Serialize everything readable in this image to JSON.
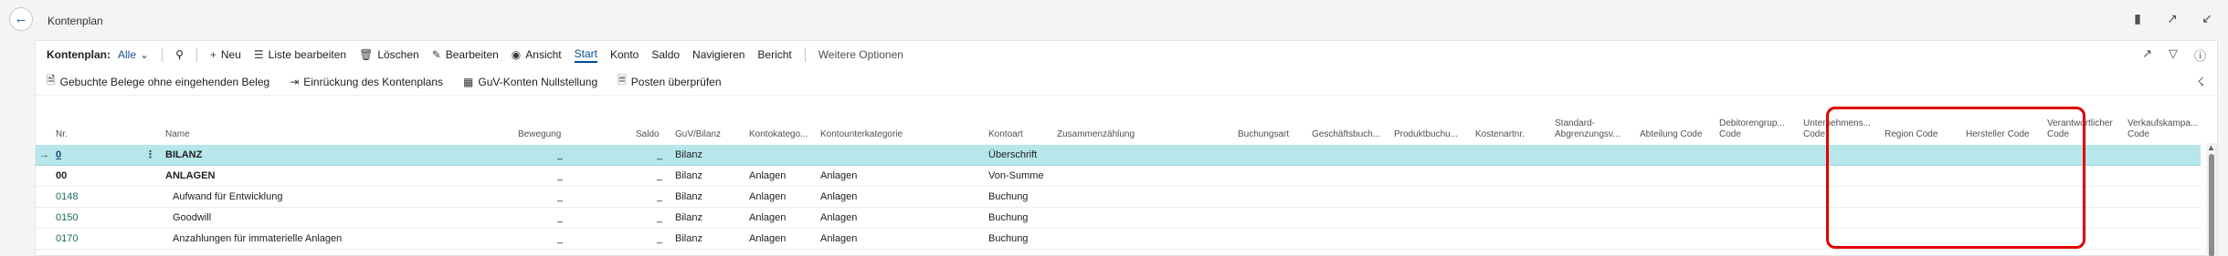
{
  "window": {
    "title": "Kontenplan"
  },
  "actions": {
    "view_label": "Kontenplan:",
    "filter_value": "Alle",
    "new": "Neu",
    "edit_list": "Liste bearbeiten",
    "delete": "Löschen",
    "edit": "Bearbeiten",
    "view": "Ansicht",
    "start": "Start",
    "konto": "Konto",
    "saldo": "Saldo",
    "navigate": "Navigieren",
    "report": "Bericht",
    "more": "Weitere Optionen"
  },
  "promoted": {
    "a1": "Gebuchte Belege ohne eingehenden Beleg",
    "a2": "Einrückung des Kontenplans",
    "a3": "GuV-Konten Nullstellung",
    "a4": "Posten überprüfen"
  },
  "columns": {
    "nr": "Nr.",
    "name": "Name",
    "bewegung": "Bewegung",
    "saldo": "Saldo",
    "guv": "GuV/Bilanz",
    "kontokat": "Kontokatego...",
    "kontounterkat": "Kontounterkategorie",
    "kontoart": "Kontoart",
    "zusammen": "Zusammenzählung",
    "buchungsart": "Buchungsart",
    "geschbuch": "Geschäftsbuch...",
    "prodbuch": "Produktbuchu...",
    "kostenart": "Kostenartnr.",
    "standard": "Standard-Abgrenzungsv...",
    "abteilung": "Abteilung Code",
    "debitor": "Debitorengrup... Code",
    "unternehmen": "Unternehmens... Code",
    "region": "Region Code",
    "hersteller": "Hersteller Code",
    "verantwortlich": "Verantwortlicher Code",
    "verkauf": "Verkaufskampa... Code"
  },
  "rows": [
    {
      "nr": "0",
      "name": "BILANZ",
      "bewegung": "_",
      "saldo": "_",
      "guv": "Bilanz",
      "kontokat": "",
      "kontounterkat": "",
      "kontoart": "Überschrift"
    },
    {
      "nr": "00",
      "name": "ANLAGEN",
      "bewegung": "_",
      "saldo": "_",
      "guv": "Bilanz",
      "kontokat": "Anlagen",
      "kontounterkat": "Anlagen",
      "kontoart": "Von-Summe"
    },
    {
      "nr": "0148",
      "name": "Aufwand für Entwicklung",
      "bewegung": "_",
      "saldo": "_",
      "guv": "Bilanz",
      "kontokat": "Anlagen",
      "kontounterkat": "Anlagen",
      "kontoart": "Buchung"
    },
    {
      "nr": "0150",
      "name": "Goodwill",
      "bewegung": "_",
      "saldo": "_",
      "guv": "Bilanz",
      "kontokat": "Anlagen",
      "kontounterkat": "Anlagen",
      "kontoart": "Buchung"
    },
    {
      "nr": "0170",
      "name": "Anzahlungen für immaterielle Anlagen",
      "bewegung": "_",
      "saldo": "_",
      "guv": "Bilanz",
      "kontokat": "Anlagen",
      "kontounterkat": "Anlagen",
      "kontoart": "Buchung"
    }
  ],
  "colors": {
    "accent": "#004e8c",
    "selected_row": "#b7e7ea",
    "highlight": "#e00000",
    "link": "#1b6d5f"
  },
  "icons": [
    "back-arrow-icon",
    "bookmark-icon",
    "open-new-window-icon",
    "collapse-icon",
    "search-icon",
    "plus-icon",
    "list-edit-icon",
    "trash-icon",
    "pencil-icon",
    "eye-icon",
    "share-icon",
    "filter-icon",
    "info-icon",
    "pin-icon"
  ]
}
